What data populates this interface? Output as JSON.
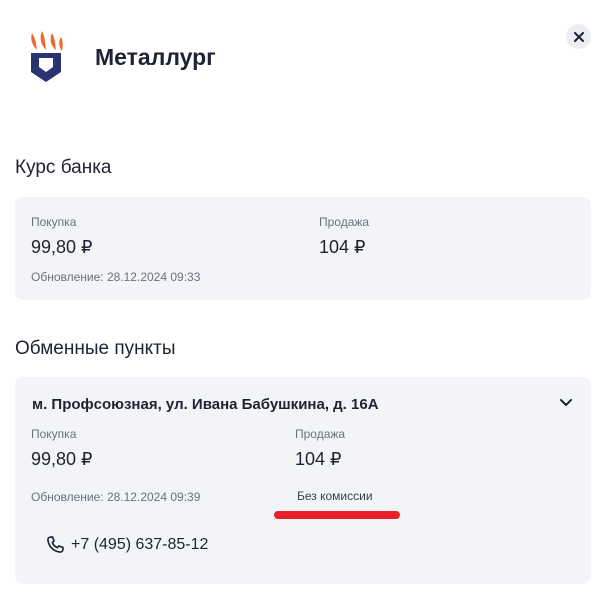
{
  "header": {
    "bank_name": "Металлург"
  },
  "bank_rate": {
    "title": "Курс банка",
    "buy_label": "Покупка",
    "buy_value": "99,80 ₽",
    "sell_label": "Продажа",
    "sell_value": "104 ₽",
    "updated": "Обновление: 28.12.2024 09:33"
  },
  "exchange_points": {
    "title": "Обменные пункты",
    "items": [
      {
        "address": "м. Профсоюзная, ул. Ивана Бабушкина, д. 16А",
        "buy_label": "Покупка",
        "buy_value": "99,80 ₽",
        "sell_label": "Продажа",
        "sell_value": "104 ₽",
        "updated": "Обновление: 28.12.2024 09:39",
        "fee_note": "Без комиссии",
        "phone": "+7 (495) 637-85-12"
      }
    ]
  },
  "colors": {
    "logo_orange": "#f0682a",
    "logo_navy": "#2b3470",
    "highlight_red": "#e8202a",
    "card_bg": "#f3f4f7"
  },
  "icons": {
    "close": "close-icon",
    "chevron": "chevron-down-icon",
    "phone": "phone-icon"
  }
}
